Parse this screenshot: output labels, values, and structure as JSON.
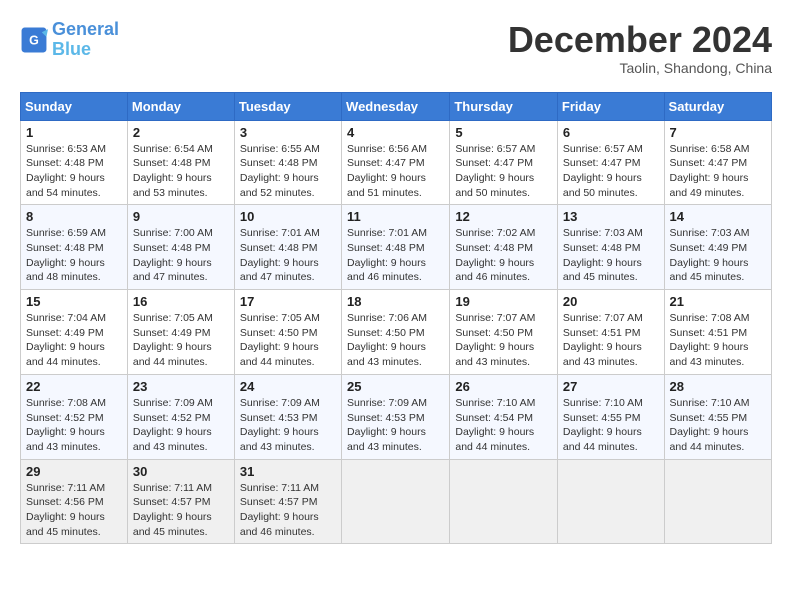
{
  "header": {
    "logo_line1": "General",
    "logo_line2": "Blue",
    "month": "December 2024",
    "location": "Taolin, Shandong, China"
  },
  "weekdays": [
    "Sunday",
    "Monday",
    "Tuesday",
    "Wednesday",
    "Thursday",
    "Friday",
    "Saturday"
  ],
  "weeks": [
    [
      {
        "day": "1",
        "sunrise": "6:53 AM",
        "sunset": "4:48 PM",
        "daylight": "9 hours and 54 minutes."
      },
      {
        "day": "2",
        "sunrise": "6:54 AM",
        "sunset": "4:48 PM",
        "daylight": "9 hours and 53 minutes."
      },
      {
        "day": "3",
        "sunrise": "6:55 AM",
        "sunset": "4:48 PM",
        "daylight": "9 hours and 52 minutes."
      },
      {
        "day": "4",
        "sunrise": "6:56 AM",
        "sunset": "4:47 PM",
        "daylight": "9 hours and 51 minutes."
      },
      {
        "day": "5",
        "sunrise": "6:57 AM",
        "sunset": "4:47 PM",
        "daylight": "9 hours and 50 minutes."
      },
      {
        "day": "6",
        "sunrise": "6:57 AM",
        "sunset": "4:47 PM",
        "daylight": "9 hours and 50 minutes."
      },
      {
        "day": "7",
        "sunrise": "6:58 AM",
        "sunset": "4:47 PM",
        "daylight": "9 hours and 49 minutes."
      }
    ],
    [
      {
        "day": "8",
        "sunrise": "6:59 AM",
        "sunset": "4:48 PM",
        "daylight": "9 hours and 48 minutes."
      },
      {
        "day": "9",
        "sunrise": "7:00 AM",
        "sunset": "4:48 PM",
        "daylight": "9 hours and 47 minutes."
      },
      {
        "day": "10",
        "sunrise": "7:01 AM",
        "sunset": "4:48 PM",
        "daylight": "9 hours and 47 minutes."
      },
      {
        "day": "11",
        "sunrise": "7:01 AM",
        "sunset": "4:48 PM",
        "daylight": "9 hours and 46 minutes."
      },
      {
        "day": "12",
        "sunrise": "7:02 AM",
        "sunset": "4:48 PM",
        "daylight": "9 hours and 46 minutes."
      },
      {
        "day": "13",
        "sunrise": "7:03 AM",
        "sunset": "4:48 PM",
        "daylight": "9 hours and 45 minutes."
      },
      {
        "day": "14",
        "sunrise": "7:03 AM",
        "sunset": "4:49 PM",
        "daylight": "9 hours and 45 minutes."
      }
    ],
    [
      {
        "day": "15",
        "sunrise": "7:04 AM",
        "sunset": "4:49 PM",
        "daylight": "9 hours and 44 minutes."
      },
      {
        "day": "16",
        "sunrise": "7:05 AM",
        "sunset": "4:49 PM",
        "daylight": "9 hours and 44 minutes."
      },
      {
        "day": "17",
        "sunrise": "7:05 AM",
        "sunset": "4:50 PM",
        "daylight": "9 hours and 44 minutes."
      },
      {
        "day": "18",
        "sunrise": "7:06 AM",
        "sunset": "4:50 PM",
        "daylight": "9 hours and 43 minutes."
      },
      {
        "day": "19",
        "sunrise": "7:07 AM",
        "sunset": "4:50 PM",
        "daylight": "9 hours and 43 minutes."
      },
      {
        "day": "20",
        "sunrise": "7:07 AM",
        "sunset": "4:51 PM",
        "daylight": "9 hours and 43 minutes."
      },
      {
        "day": "21",
        "sunrise": "7:08 AM",
        "sunset": "4:51 PM",
        "daylight": "9 hours and 43 minutes."
      }
    ],
    [
      {
        "day": "22",
        "sunrise": "7:08 AM",
        "sunset": "4:52 PM",
        "daylight": "9 hours and 43 minutes."
      },
      {
        "day": "23",
        "sunrise": "7:09 AM",
        "sunset": "4:52 PM",
        "daylight": "9 hours and 43 minutes."
      },
      {
        "day": "24",
        "sunrise": "7:09 AM",
        "sunset": "4:53 PM",
        "daylight": "9 hours and 43 minutes."
      },
      {
        "day": "25",
        "sunrise": "7:09 AM",
        "sunset": "4:53 PM",
        "daylight": "9 hours and 43 minutes."
      },
      {
        "day": "26",
        "sunrise": "7:10 AM",
        "sunset": "4:54 PM",
        "daylight": "9 hours and 44 minutes."
      },
      {
        "day": "27",
        "sunrise": "7:10 AM",
        "sunset": "4:55 PM",
        "daylight": "9 hours and 44 minutes."
      },
      {
        "day": "28",
        "sunrise": "7:10 AM",
        "sunset": "4:55 PM",
        "daylight": "9 hours and 44 minutes."
      }
    ],
    [
      {
        "day": "29",
        "sunrise": "7:11 AM",
        "sunset": "4:56 PM",
        "daylight": "9 hours and 45 minutes."
      },
      {
        "day": "30",
        "sunrise": "7:11 AM",
        "sunset": "4:57 PM",
        "daylight": "9 hours and 45 minutes."
      },
      {
        "day": "31",
        "sunrise": "7:11 AM",
        "sunset": "4:57 PM",
        "daylight": "9 hours and 46 minutes."
      },
      null,
      null,
      null,
      null
    ]
  ],
  "labels": {
    "sunrise": "Sunrise:",
    "sunset": "Sunset:",
    "daylight": "Daylight:"
  }
}
